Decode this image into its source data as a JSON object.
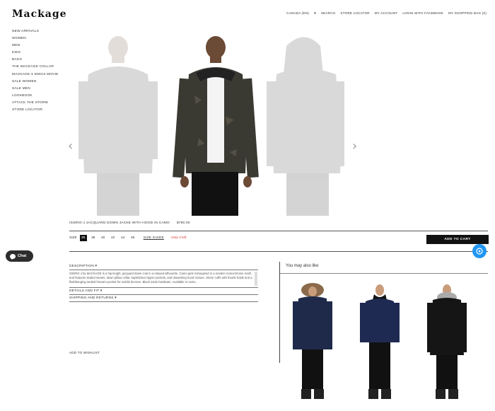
{
  "brand": {
    "logo": "Mackage"
  },
  "topnav": [
    "CANADA (EN)",
    "♥",
    "SEARCH",
    "STORE LOCATOR",
    "MY ACCOUNT",
    "LOGIN WITH FACEBOOK",
    "MY SHOPPING BAG (0)"
  ],
  "sidenav": [
    "NEW ARRIVALS",
    "WOMEN",
    "MEN",
    "KIDS",
    "BAGS",
    "THE MACKAGE COLLAR",
    "MACKAGE X EMOJI MOVIE",
    "SALE WOMEN",
    "SALE MEN",
    "LOOKBOOK",
    "ATTACK THE STORM",
    "STORE LOCATOR"
  ],
  "product": {
    "name": "ISIDRO-J JACQUARD DOWN JACKE WITH HOOD IN CAMO",
    "price": "$790.00",
    "size_label": "SIZE",
    "sizes": [
      "36",
      "38",
      "40",
      "42",
      "44",
      "46"
    ],
    "size_guide": "SIZE GUIDE",
    "stock_note": "Only 3 left",
    "add_to_cart": "ADD TO CART"
  },
  "details": {
    "description_label": "DESCRIPTION ▾",
    "description_text": "ISIDRO-J by MACKAGE is a hip length, jacquard down coat in a relaxed silhouette. Camo gets reimagined in a modern monochrome motif, and features sealed seams, down pillow collar, topstitched zipper pockets, and drawstring hood closure. Storm cuffs with thumb holds and a flashbanging sealed forearm pocket for mobile devices. Black oxide hardware. Available in camo.",
    "details_label": "DETAILS AND FIT ▾",
    "shipping_label": "SHIPPING AND RETURNS ▾",
    "wishlist": "ADD TO WISHLIST"
  },
  "also_like": {
    "title": "You may also like"
  },
  "chat": {
    "label": "Chat"
  },
  "icons": {
    "prev": "chevron-left-icon",
    "next": "chevron-right-icon",
    "chat": "chat-bubble-icon",
    "fab": "chat-widget-icon"
  }
}
